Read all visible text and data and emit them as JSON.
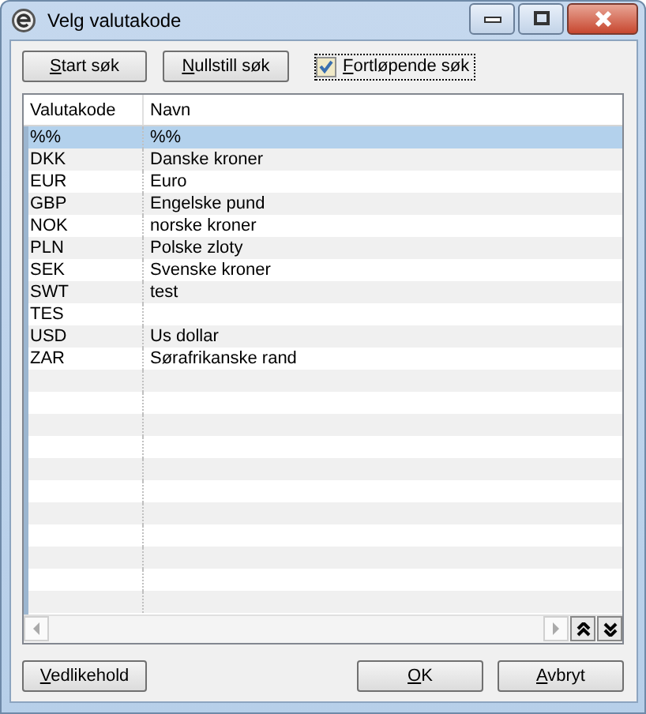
{
  "window": {
    "title": "Velg valutakode"
  },
  "toolbar": {
    "buttons": [
      "Start søk",
      "Nullstill søk"
    ],
    "checkbox": {
      "label": "Fortløpende søk",
      "checked": true
    }
  },
  "table": {
    "columns": [
      "Valutakode",
      "Navn"
    ],
    "rows": [
      {
        "cells": [
          "%%",
          "%%"
        ],
        "selected": true
      },
      {
        "cells": [
          "DKK",
          "Danske kroner"
        ],
        "selected": false
      },
      {
        "cells": [
          "EUR",
          "Euro"
        ],
        "selected": false
      },
      {
        "cells": [
          "GBP",
          "Engelske pund"
        ],
        "selected": false
      },
      {
        "cells": [
          "NOK",
          "norske kroner"
        ],
        "selected": false
      },
      {
        "cells": [
          "PLN",
          "Polske zloty"
        ],
        "selected": false
      },
      {
        "cells": [
          "SEK",
          "Svenske kroner"
        ],
        "selected": false
      },
      {
        "cells": [
          "SWT",
          "test"
        ],
        "selected": false
      },
      {
        "cells": [
          "TES",
          ""
        ],
        "selected": false
      },
      {
        "cells": [
          "USD",
          "Us dollar"
        ],
        "selected": false
      },
      {
        "cells": [
          "ZAR",
          "Sørafrikanske rand"
        ],
        "selected": false
      }
    ]
  },
  "footer": {
    "left_button": "Vedlikehold",
    "right_buttons": [
      "OK",
      "Avbryt"
    ]
  }
}
